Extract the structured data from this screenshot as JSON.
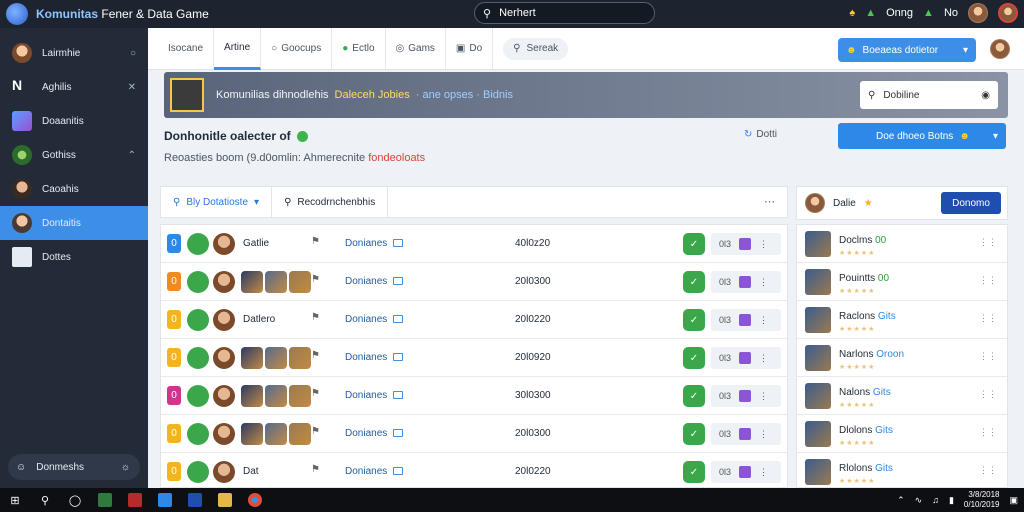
{
  "app": {
    "title_prefix": "Komunitas",
    "title_suffix": "Fener & Data Game",
    "search": "Nerhert"
  },
  "topbar": {
    "status_text": "Onng",
    "status_text_2": "No"
  },
  "sidebar": {
    "items": [
      {
        "label": "Lairmhie",
        "icon": "profile-icon"
      },
      {
        "label": "Aghilis",
        "icon": "nx-icon"
      },
      {
        "label": "Doaanitis",
        "icon": "game-icon"
      },
      {
        "label": "Gothiss",
        "icon": "avatar-icon"
      },
      {
        "label": "Caoahis",
        "icon": "avatar-icon"
      },
      {
        "label": "Dontaitis",
        "icon": "avatar-icon"
      },
      {
        "label": "Dottes",
        "icon": "grid-icon"
      }
    ],
    "community_button": "Donmeshs"
  },
  "tabs": [
    {
      "label": "Isocane"
    },
    {
      "label": "Artine"
    },
    {
      "label": "Goocups"
    },
    {
      "label": "Ectlo"
    },
    {
      "label": "Gams"
    },
    {
      "label": "Do"
    }
  ],
  "tab_search": "Sereak",
  "tab_action": "Boeaeas dotietor",
  "banner": {
    "text_main": "Komunilias dihnodlehis",
    "text_mid": "Daleceh Jobies",
    "text_end": "· ane opses · Bidnis",
    "search_placeholder": "Dobiline"
  },
  "section": {
    "title": "Donhonitle oalecter of",
    "subtitle_main": "Reoasties boom (9.d0omlin: Ahmerecnite",
    "subtitle_red": "fondeoloats",
    "link": "Dotti",
    "action": "Doe dhoeo Botns"
  },
  "filters": {
    "first": "Bly Dotatioste",
    "second": "Recodrnchenbhis"
  },
  "right_card": {
    "name": "Dalie"
  },
  "follow_button": "Donomo",
  "rows": [
    {
      "chip": "0",
      "chip_color": "#2e88e8",
      "name": "Gatlie",
      "category": "Donianes",
      "number": "40l0z20",
      "meta": "0l3"
    },
    {
      "chip": "0",
      "chip_color": "#f28a22",
      "name": "",
      "category": "Donianes",
      "number": "20l0300",
      "meta": "0l3"
    },
    {
      "chip": "0",
      "chip_color": "#f2b51d",
      "name": "Datlero",
      "category": "Donianes",
      "number": "20l0220",
      "meta": "0l3"
    },
    {
      "chip": "0",
      "chip_color": "#f2b51d",
      "name": "",
      "category": "Donianes",
      "number": "20l0920",
      "meta": "0l3"
    },
    {
      "chip": "0",
      "chip_color": "#d1348b",
      "name": "",
      "category": "Donianes",
      "number": "30l0300",
      "meta": "0l3"
    },
    {
      "chip": "0",
      "chip_color": "#f2b51d",
      "name": "",
      "category": "Donianes",
      "number": "20l0300",
      "meta": "0l3"
    },
    {
      "chip": "0",
      "chip_color": "#f2b51d",
      "name": "Dat",
      "category": "Donianes",
      "number": "20l0220",
      "meta": "0l3"
    }
  ],
  "right_list": [
    {
      "name": "Doclms",
      "tag": "00",
      "tag_color": "g"
    },
    {
      "name": "Pouintts",
      "tag": "00",
      "tag_color": "g"
    },
    {
      "name": "Raclons",
      "tag": "Gits",
      "tag_color": "b"
    },
    {
      "name": "Narlons",
      "tag": "Oroon",
      "tag_color": "b"
    },
    {
      "name": "Nalons",
      "tag": "Gits",
      "tag_color": "b"
    },
    {
      "name": "Dlolons",
      "tag": "Gits",
      "tag_color": "b"
    },
    {
      "name": "Rlolons",
      "tag": "Gits",
      "tag_color": "b"
    }
  ],
  "taskbar": {
    "clock_line1": "3/8/2018",
    "clock_line2": "0/10/2019"
  }
}
